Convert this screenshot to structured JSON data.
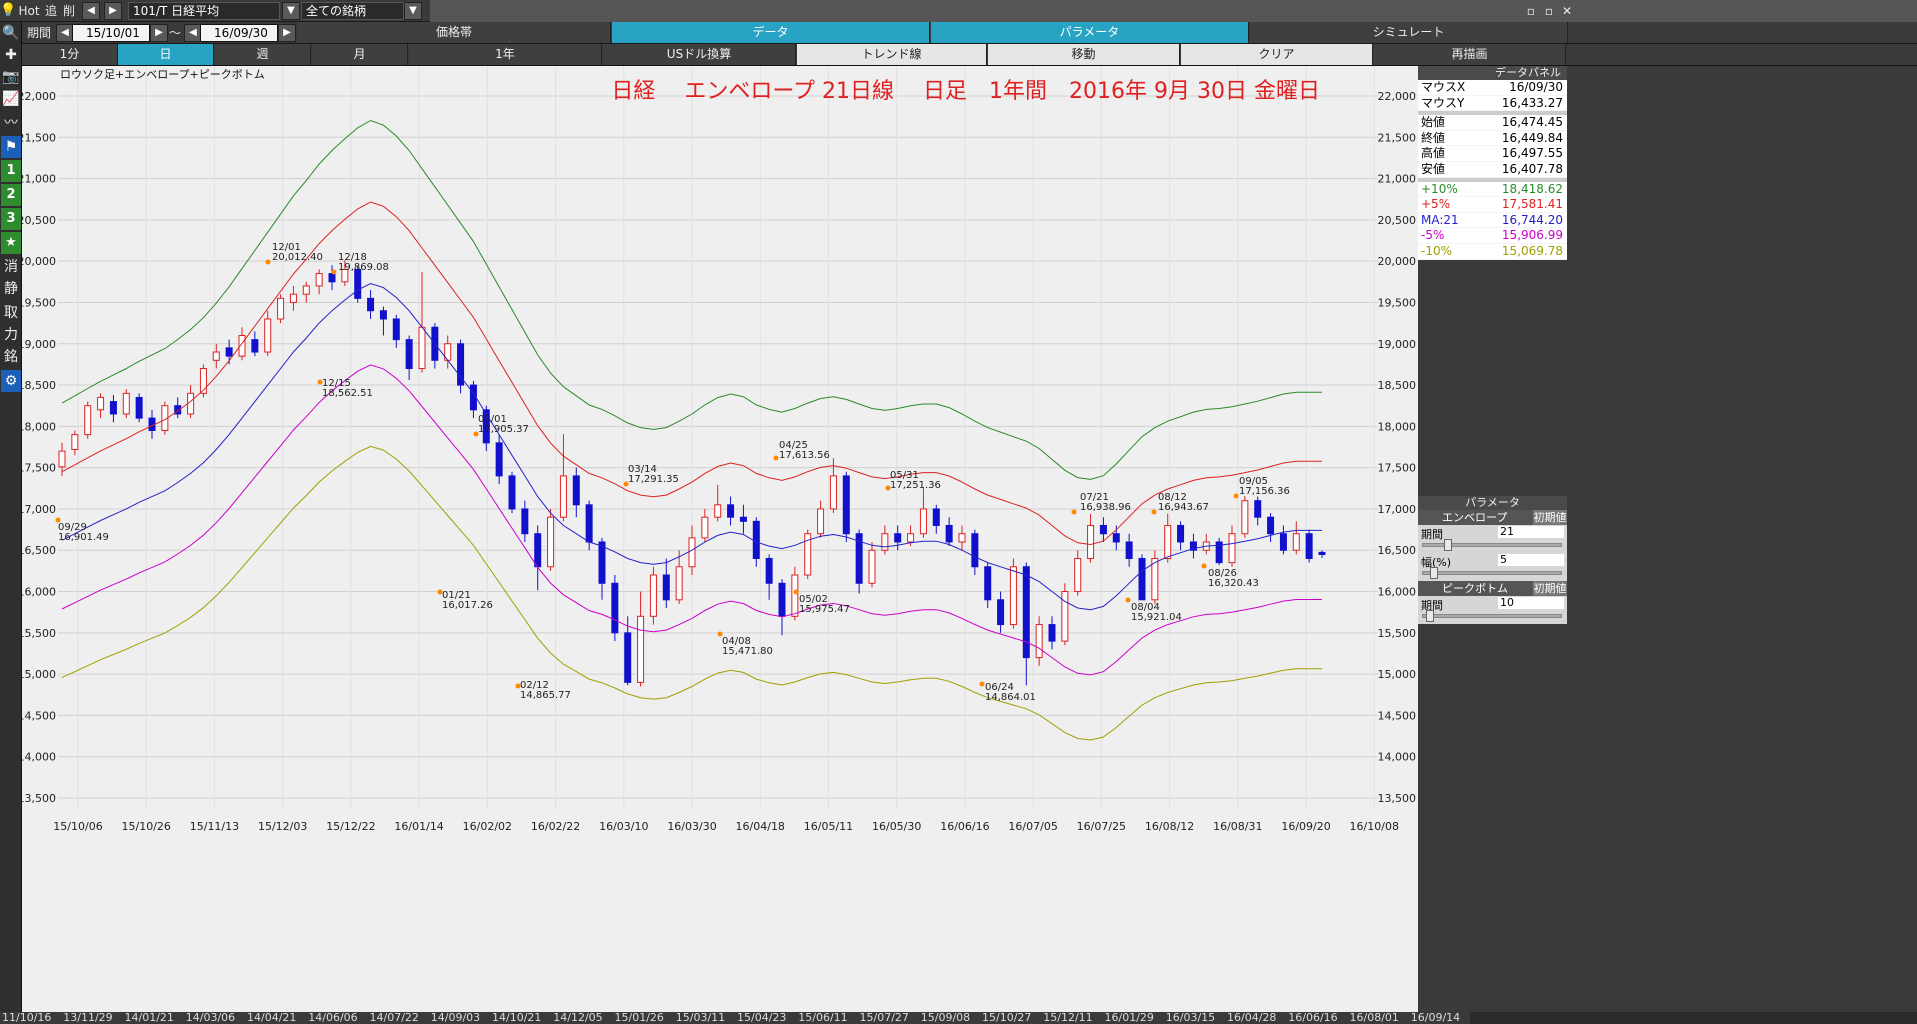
{
  "topbar": {
    "hot": "Hot",
    "add": "追",
    "del": "削",
    "symbol": "101/T 日経平均",
    "universe": "全ての銘柄",
    "period_label": "期間",
    "date_from": "15/10/01",
    "tilde": "～",
    "date_to": "16/09/30",
    "tabs1": [
      "価格帯",
      "データ",
      "パラメータ",
      "シミュレート"
    ],
    "tabs2": [
      "1分",
      "日",
      "週",
      "月",
      "1年",
      "USドル換算",
      "トレンド線",
      "移動",
      "クリア",
      "再描画"
    ]
  },
  "left_toolbar": [
    {
      "icon": "search-icon",
      "glyph": "🔍"
    },
    {
      "icon": "crosshair-icon",
      "glyph": "✚"
    },
    {
      "icon": "camera-icon",
      "glyph": "📷"
    },
    {
      "icon": "line-chart-icon",
      "glyph": "📈"
    },
    {
      "icon": "indicator-icon",
      "glyph": "〰"
    },
    {
      "icon": "flag-icon",
      "glyph": "⚑"
    },
    {
      "icon": "one-icon",
      "glyph": "1"
    },
    {
      "icon": "two-icon",
      "glyph": "2"
    },
    {
      "icon": "three-icon",
      "glyph": "3"
    },
    {
      "icon": "star-icon",
      "glyph": "★"
    },
    {
      "icon": "erase-icon",
      "glyph": "消"
    },
    {
      "icon": "static-icon",
      "glyph": "静"
    },
    {
      "icon": "take-icon",
      "glyph": "取"
    },
    {
      "icon": "power-icon",
      "glyph": "力"
    },
    {
      "icon": "stock-icon",
      "glyph": "銘"
    },
    {
      "icon": "settings-icon",
      "glyph": "⚙"
    }
  ],
  "chart_data": {
    "type": "candlestick",
    "indicator_label": "ロウソク足+エンベロープ+ピークボトム",
    "title": "日経　 エンベロープ 21日線　 日足　1年間　2016年 9月 30日 金曜日",
    "y_ticks": [
      22000,
      21500,
      21000,
      20500,
      20000,
      19500,
      19000,
      18500,
      18000,
      17500,
      17000,
      16500,
      16000,
      15500,
      15000,
      14500,
      14000,
      13500
    ],
    "ylim": [
      13500,
      22000
    ],
    "x_tick_labels": [
      "15/10/06",
      "15/10/26",
      "15/11/13",
      "15/12/03",
      "15/12/22",
      "16/01/14",
      "16/02/02",
      "16/02/22",
      "16/03/10",
      "16/03/30",
      "16/04/18",
      "16/05/11",
      "16/05/30",
      "16/06/16",
      "16/07/05",
      "16/07/25",
      "16/08/12",
      "16/08/31",
      "16/09/20",
      "16/10/08"
    ],
    "ma_21": [
      16620,
      16700,
      16780,
      16860,
      16930,
      17000,
      17080,
      17150,
      17220,
      17320,
      17430,
      17560,
      17720,
      17900,
      18100,
      18300,
      18500,
      18700,
      18900,
      19070,
      19250,
      19400,
      19530,
      19650,
      19730,
      19680,
      19560,
      19400,
      19200,
      19000,
      18800,
      18600,
      18400,
      18150,
      17900,
      17650,
      17400,
      17150,
      16950,
      16800,
      16700,
      16600,
      16550,
      16480,
      16400,
      16350,
      16330,
      16350,
      16420,
      16500,
      16600,
      16680,
      16720,
      16690,
      16600,
      16550,
      16520,
      16560,
      16620,
      16670,
      16690,
      16660,
      16610,
      16560,
      16540,
      16560,
      16590,
      16610,
      16610,
      16570,
      16500,
      16420,
      16350,
      16300,
      16250,
      16200,
      16120,
      16000,
      15880,
      15800,
      15780,
      15820,
      15950,
      16100,
      16250,
      16350,
      16420,
      16470,
      16520,
      16550,
      16560,
      16580,
      16610,
      16640,
      16680,
      16720,
      16740,
      16740,
      16740
    ],
    "envelope": [
      {
        "name": "+10%",
        "color": "#2a8a2a"
      },
      {
        "name": "+5%",
        "color": "#d22"
      },
      {
        "name": "MA:21",
        "color": "#22c"
      },
      {
        "name": "-5%",
        "color": "#c0c"
      },
      {
        "name": "-10%",
        "color": "#a0a000"
      }
    ],
    "candles": [
      [
        17510,
        17700,
        17400,
        17800
      ],
      [
        17720,
        17900,
        17650,
        17950
      ],
      [
        17900,
        18250,
        17850,
        18300
      ],
      [
        18200,
        18350,
        18100,
        18400
      ],
      [
        18300,
        18150,
        18050,
        18380
      ],
      [
        18150,
        18400,
        18100,
        18450
      ],
      [
        18350,
        18100,
        18050,
        18400
      ],
      [
        18100,
        17950,
        17850,
        18200
      ],
      [
        17950,
        18250,
        17900,
        18300
      ],
      [
        18250,
        18150,
        18100,
        18350
      ],
      [
        18150,
        18400,
        18100,
        18500
      ],
      [
        18400,
        18700,
        18350,
        18750
      ],
      [
        18800,
        18900,
        18700,
        19000
      ],
      [
        18950,
        18850,
        18750,
        19050
      ],
      [
        18850,
        19100,
        18800,
        19200
      ],
      [
        19050,
        18900,
        18850,
        19150
      ],
      [
        18900,
        19300,
        18850,
        19400
      ],
      [
        19300,
        19550,
        19250,
        19600
      ],
      [
        19500,
        19600,
        19400,
        19700
      ],
      [
        19600,
        19700,
        19500,
        19750
      ],
      [
        19700,
        19850,
        19600,
        19900
      ],
      [
        19850,
        19750,
        19650,
        19950
      ],
      [
        19750,
        19900,
        19700,
        20012
      ],
      [
        19900,
        19550,
        19500,
        19950
      ],
      [
        19550,
        19400,
        19300,
        19650
      ],
      [
        19400,
        19300,
        19100,
        19450
      ],
      [
        19300,
        19050,
        18950,
        19350
      ],
      [
        19050,
        18700,
        18562,
        19100
      ],
      [
        18700,
        19200,
        18650,
        19869
      ],
      [
        19200,
        18800,
        18700,
        19250
      ],
      [
        18800,
        19000,
        18700,
        19100
      ],
      [
        19000,
        18500,
        18400,
        19050
      ],
      [
        18500,
        18200,
        18100,
        18550
      ],
      [
        18200,
        17800,
        17700,
        18250
      ],
      [
        17800,
        17400,
        17300,
        17900
      ],
      [
        17400,
        17000,
        16950,
        17450
      ],
      [
        17000,
        16700,
        16600,
        17100
      ],
      [
        16700,
        16300,
        16017,
        16800
      ],
      [
        16300,
        16900,
        16250,
        17000
      ],
      [
        16900,
        17400,
        16850,
        17905
      ],
      [
        17400,
        17050,
        16900,
        17500
      ],
      [
        17050,
        16600,
        16500,
        17100
      ],
      [
        16600,
        16100,
        15900,
        16650
      ],
      [
        16100,
        15500,
        15400,
        16200
      ],
      [
        15500,
        14900,
        14865,
        15700
      ],
      [
        14900,
        15700,
        14850,
        16000
      ],
      [
        15700,
        16200,
        15600,
        16300
      ],
      [
        16200,
        15900,
        15800,
        16400
      ],
      [
        15900,
        16300,
        15850,
        16500
      ],
      [
        16300,
        16650,
        16200,
        16800
      ],
      [
        16650,
        16900,
        16600,
        17000
      ],
      [
        16900,
        17050,
        16850,
        17291
      ],
      [
        17050,
        16900,
        16800,
        17150
      ],
      [
        16900,
        16850,
        16700,
        17050
      ],
      [
        16850,
        16400,
        16300,
        16900
      ],
      [
        16400,
        16100,
        15900,
        16450
      ],
      [
        16100,
        15700,
        15471,
        16150
      ],
      [
        15700,
        16200,
        15650,
        16300
      ],
      [
        16200,
        16700,
        16150,
        16750
      ],
      [
        16700,
        17000,
        16650,
        17100
      ],
      [
        17000,
        17400,
        16950,
        17613
      ],
      [
        17400,
        16700,
        16600,
        17450
      ],
      [
        16700,
        16100,
        15975,
        16750
      ],
      [
        16100,
        16500,
        16050,
        16600
      ],
      [
        16500,
        16700,
        16450,
        16800
      ],
      [
        16700,
        16600,
        16500,
        16800
      ],
      [
        16600,
        16700,
        16550,
        16800
      ],
      [
        16700,
        17000,
        16650,
        17251
      ],
      [
        17000,
        16800,
        16700,
        17050
      ],
      [
        16800,
        16600,
        16550,
        16900
      ],
      [
        16600,
        16700,
        16500,
        16800
      ],
      [
        16700,
        16300,
        16200,
        16750
      ],
      [
        16300,
        15900,
        15800,
        16350
      ],
      [
        15900,
        15600,
        15500,
        16000
      ],
      [
        15600,
        16300,
        15550,
        16400
      ],
      [
        16300,
        15200,
        14864,
        16350
      ],
      [
        15200,
        15600,
        15100,
        15700
      ],
      [
        15600,
        15400,
        15300,
        15700
      ],
      [
        15400,
        16000,
        15350,
        16100
      ],
      [
        16000,
        16400,
        15950,
        16500
      ],
      [
        16400,
        16800,
        16350,
        16938
      ],
      [
        16800,
        16700,
        16600,
        16900
      ],
      [
        16700,
        16600,
        16500,
        16800
      ],
      [
        16600,
        16400,
        16300,
        16700
      ],
      [
        16400,
        15900,
        15921,
        16450
      ],
      [
        15900,
        16400,
        15850,
        16500
      ],
      [
        16400,
        16800,
        16350,
        16943
      ],
      [
        16800,
        16600,
        16500,
        16850
      ],
      [
        16600,
        16500,
        16400,
        16700
      ],
      [
        16500,
        16600,
        16450,
        16700
      ],
      [
        16600,
        16350,
        16320,
        16650
      ],
      [
        16350,
        16700,
        16300,
        16800
      ],
      [
        16700,
        17100,
        16650,
        17156
      ],
      [
        17100,
        16900,
        16800,
        17150
      ],
      [
        16900,
        16700,
        16600,
        16950
      ],
      [
        16700,
        16500,
        16450,
        16800
      ],
      [
        16500,
        16700,
        16450,
        16850
      ],
      [
        16700,
        16400,
        16350,
        16750
      ],
      [
        16474,
        16449,
        16407,
        16497
      ]
    ],
    "annotations": [
      {
        "date": "09/29",
        "value": "16,901.49"
      },
      {
        "date": "12/01",
        "value": "20,012.40"
      },
      {
        "date": "12/18",
        "value": "19,869.08"
      },
      {
        "date": "12/15",
        "value": "18,562.51"
      },
      {
        "date": "02/01",
        "value": "17,905.37"
      },
      {
        "date": "01/21",
        "value": "16,017.26"
      },
      {
        "date": "02/12",
        "value": "14,865.77"
      },
      {
        "date": "03/14",
        "value": "17,291.35"
      },
      {
        "date": "04/08",
        "value": "15,471.80"
      },
      {
        "date": "04/25",
        "value": "17,613.56"
      },
      {
        "date": "05/02",
        "value": "15,975.47"
      },
      {
        "date": "05/31",
        "value": "17,251.36"
      },
      {
        "date": "06/24",
        "value": "14,864.01"
      },
      {
        "date": "07/21",
        "value": "16,938.96"
      },
      {
        "date": "08/04",
        "value": "15,921.04"
      },
      {
        "date": "08/12",
        "value": "16,943.67"
      },
      {
        "date": "08/26",
        "value": "16,320.43"
      },
      {
        "date": "09/05",
        "value": "17,156.36"
      }
    ]
  },
  "data_panel": {
    "title": "データパネル",
    "rows": [
      {
        "k": "マウスX",
        "v": "16/09/30",
        "color": "#000"
      },
      {
        "k": "マウスY",
        "v": "16,433.27",
        "color": "#000"
      },
      {
        "k": "始値",
        "v": "16,474.45",
        "color": "#000"
      },
      {
        "k": "終値",
        "v": "16,449.84",
        "color": "#000"
      },
      {
        "k": "高値",
        "v": "16,497.55",
        "color": "#000"
      },
      {
        "k": "安値",
        "v": "16,407.78",
        "color": "#000"
      },
      {
        "k": "+10%",
        "v": "18,418.62",
        "color": "#2a8a2a"
      },
      {
        "k": "+5%",
        "v": "17,581.41",
        "color": "#d22"
      },
      {
        "k": "MA:21",
        "v": "16,744.20",
        "color": "#22c"
      },
      {
        "k": "-5%",
        "v": "15,906.99",
        "color": "#c0c"
      },
      {
        "k": "-10%",
        "v": "15,069.78",
        "color": "#a0a000"
      }
    ]
  },
  "params": {
    "title": "パラメータ",
    "envelope_label": "エンベロープ",
    "reset": "初期値",
    "period_label": "期間",
    "period_value": "21",
    "width_label": "幅(%)",
    "width_value": "5",
    "peak_label": "ピークボトム",
    "peak_period_label": "期間",
    "peak_period_value": "10"
  },
  "bottom_dates": [
    "11/10/16",
    "13/11/29",
    "14/01/21",
    "14/03/06",
    "14/04/21",
    "14/06/06",
    "14/07/22",
    "14/09/03",
    "14/10/21",
    "14/12/05",
    "15/01/26",
    "15/03/11",
    "15/04/23",
    "15/06/11",
    "15/07/27",
    "15/09/08",
    "15/10/27",
    "15/12/11",
    "16/01/29",
    "16/03/15",
    "16/04/28",
    "16/06/16",
    "16/08/01",
    "16/09/14"
  ]
}
